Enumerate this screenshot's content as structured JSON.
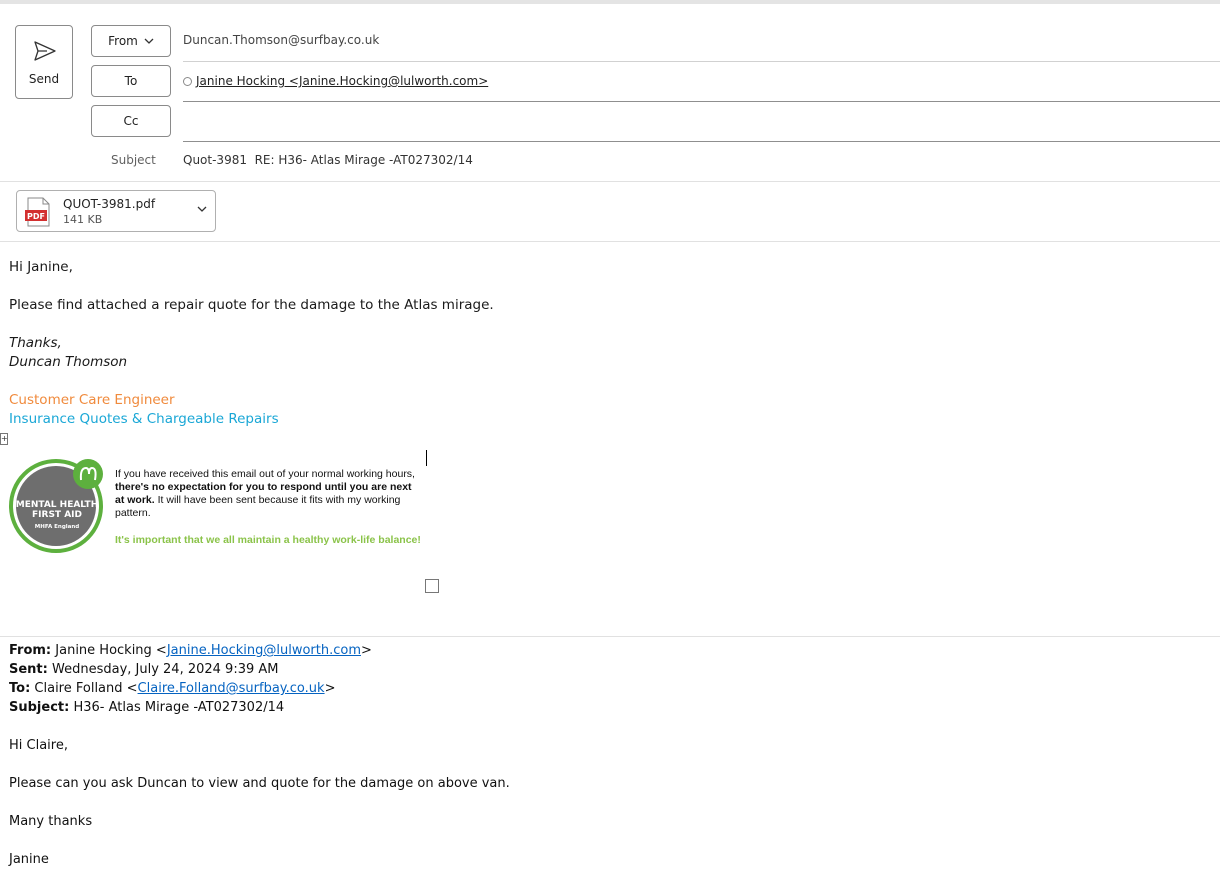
{
  "header": {
    "send_label": "Send",
    "from_label": "From",
    "to_label": "To",
    "cc_label": "Cc",
    "subject_label": "Subject",
    "from_address": "Duncan.Thomson@surfbay.co.uk",
    "to_recipient": "Janine Hocking <Janine.Hocking@lulworth.com>",
    "cc_value": "",
    "subject_value": "Quot-3981  RE: H36- Atlas Mirage -AT027302/14"
  },
  "attachment": {
    "file_name": "QUOT-3981.pdf",
    "file_size": "141 KB",
    "icon_text": "PDF"
  },
  "body": {
    "greeting": "Hi Janine,",
    "line1": "Please find attached a repair quote for the damage to the Atlas mirage.",
    "thanks": "Thanks,",
    "signer": "Duncan Thomson",
    "role": "Customer Care Engineer",
    "department": "Insurance Quotes & Chargeable Repairs",
    "sig_note_1": "If you have received this email out of your normal working hours, ",
    "sig_note_bold": "there's no expectation for you to respond until you are next at work.",
    "sig_note_2": " It will have been sent because it fits with my working pattern.",
    "sig_green": "It's important that we all maintain a healthy work-life balance!",
    "badge_line1": "MENTAL HEALTH",
    "badge_line2": "FIRST AID",
    "badge_line3": "MHFA England"
  },
  "quoted": {
    "from_label": "From:",
    "from_name": " Janine Hocking <",
    "from_email": "Janine.Hocking@lulworth.com",
    "from_end": ">",
    "sent_label": "Sent:",
    "sent_value": " Wednesday, July 24, 2024 9:39 AM",
    "to_label": "To:",
    "to_name": " Claire Folland <",
    "to_email": "Claire.Folland@surfbay.co.uk",
    "to_end": ">",
    "subject_label": "Subject:",
    "subject_value": " H36- Atlas Mirage -AT027302/14",
    "greeting": "Hi Claire,",
    "line1": "Please can you ask Duncan to view and quote for the damage on above van.",
    "thanks": "Many thanks",
    "signer": "Janine"
  },
  "colors": {
    "role": "#f08a3c",
    "department": "#1aa7d6",
    "green": "#8bc34a",
    "link": "#0563c1",
    "pdf_red": "#d32f2f"
  }
}
